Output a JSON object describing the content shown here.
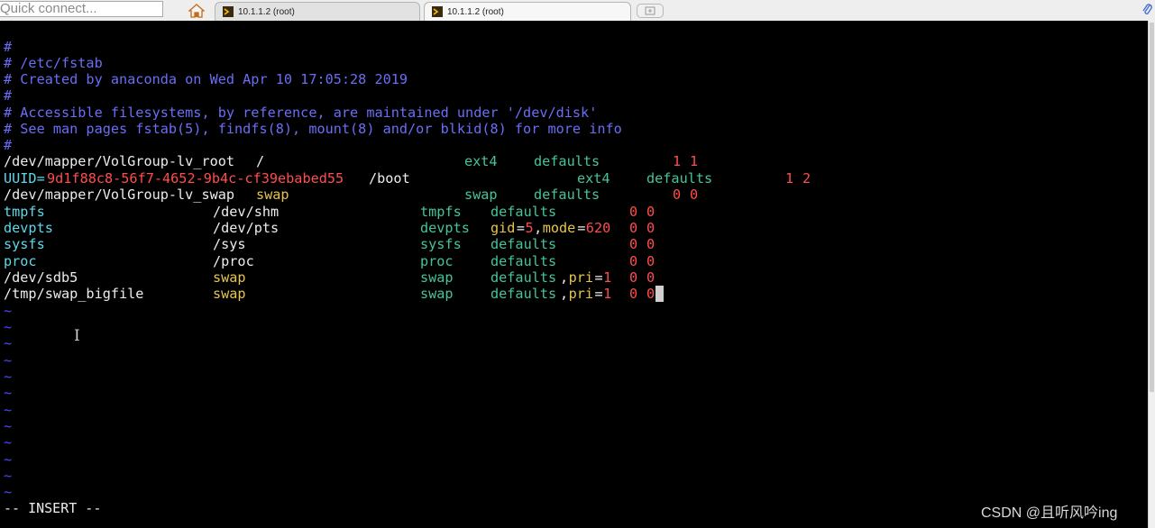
{
  "toolbar": {
    "quick_connect_placeholder": "Quick connect..."
  },
  "tabs": [
    {
      "label": "10.1.1.2 (root)",
      "icon": "terminal-tab-icon"
    },
    {
      "label": "10.1.1.2 (root)",
      "icon": "terminal-tab-icon",
      "active": true
    }
  ],
  "icons": {
    "home": "home-icon",
    "new_tab": "new-tab-icon",
    "attach": "paperclip-icon"
  },
  "editor": {
    "comments": [
      "#",
      "# /etc/fstab",
      "# Created by anaconda on Wed Apr 10 17:05:28 2019",
      "#",
      "# Accessible filesystems, by reference, are maintained under '/dev/disk'",
      "# See man pages fstab(5), findfs(8), mount(8) and/or blkid(8) for more info",
      "#"
    ],
    "entries": [
      {
        "device": "/dev/mapper/VolGroup-lv_root",
        "mount": "/",
        "fstype": "ext4",
        "options": "defaults",
        "dump": "1",
        "pass": "1"
      },
      {
        "device_key": "UUID=",
        "device_value": "9d1f88c8-56f7-4652-9b4c-cf39ebabed55",
        "mount": "/boot",
        "fstype": "ext4",
        "options": "defaults",
        "dump": "1",
        "pass": "2"
      },
      {
        "device": "/dev/mapper/VolGroup-lv_swap",
        "mount": "swap",
        "fstype": "swap",
        "options": "defaults",
        "dump": "0",
        "pass": "0"
      },
      {
        "device": "tmpfs",
        "mount": "/dev/shm",
        "fstype": "tmpfs",
        "options": "defaults",
        "dump": "0",
        "pass": "0"
      },
      {
        "device": "devpts",
        "mount": "/dev/pts",
        "fstype": "devpts",
        "opt_k1": "gid",
        "opt_eq1": "=",
        "opt_v1": "5",
        "opt_sep": ",",
        "opt_k2": "mode",
        "opt_eq2": "=",
        "opt_v2": "620",
        "dump": "0",
        "pass": "0"
      },
      {
        "device": "sysfs",
        "mount": "/sys",
        "fstype": "sysfs",
        "options": "defaults",
        "dump": "0",
        "pass": "0"
      },
      {
        "device": "proc",
        "mount": "/proc",
        "fstype": "proc",
        "options": "defaults",
        "dump": "0",
        "pass": "0"
      },
      {
        "device": "/dev/sdb5",
        "mount": "swap",
        "fstype": "swap",
        "opt_a": "defaults",
        "opt_sep": ",",
        "opt_k": "pri",
        "opt_eq": "=",
        "opt_v": "1",
        "dump": "0",
        "pass": "0"
      },
      {
        "device": "/tmp/swap_bigfile",
        "mount": "swap",
        "fstype": "swap",
        "opt_a": "defaults",
        "opt_sep": ",",
        "opt_k": "pri",
        "opt_eq": "=",
        "opt_v": "1",
        "dump": "0",
        "pass": "0"
      }
    ],
    "tilde": "~",
    "tilde_count": 12,
    "mode": "-- INSERT --"
  },
  "watermark": "CSDN @且听风吟ing",
  "colors": {
    "background": "#000000",
    "comment": "#6a6ef5",
    "fstype": "#45c49a",
    "mount": "#e8c54a",
    "number": "#ff4d4d",
    "device": "#5fd7e8"
  }
}
